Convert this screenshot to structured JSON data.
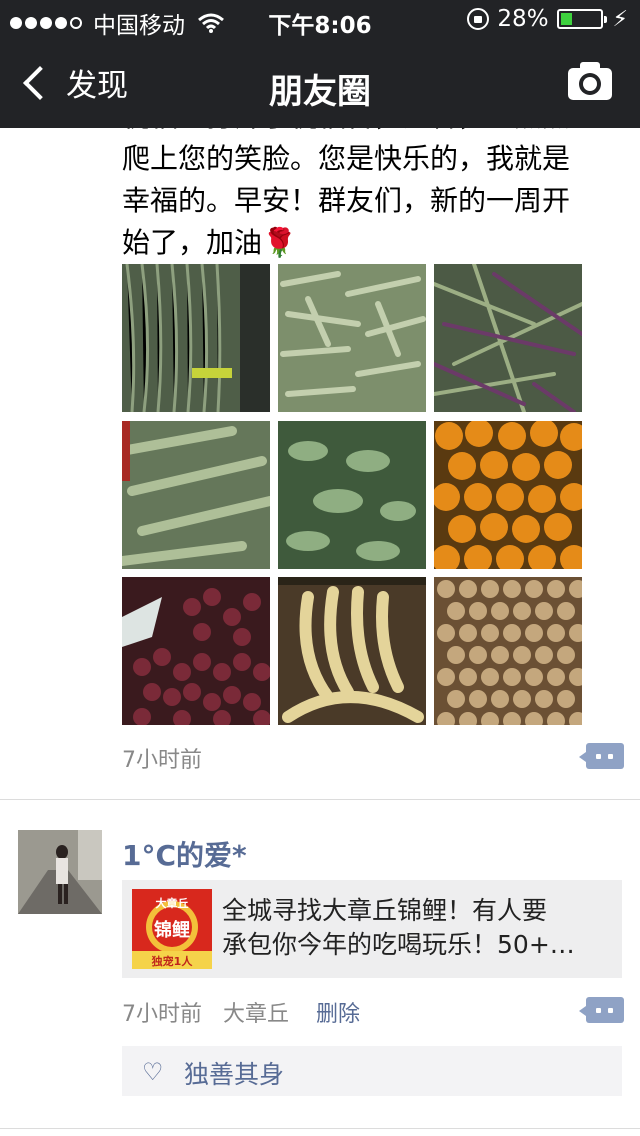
{
  "status_bar": {
    "carrier": "中国移动",
    "time": "下午8:06",
    "battery_text": "28%",
    "battery_level": 0.28
  },
  "nav": {
    "back_label": "发现",
    "title": "朋友圈"
  },
  "post1": {
    "text_lines": [
      "祝福…打开了祝福音，温馨，一点点",
      "爬上您的笑脸。您是快乐的，我就是",
      "幸福的。早安！群友们，新的一周开",
      "始了，加油🌹"
    ],
    "photos": [
      "green-long-beans",
      "pale-green-beans",
      "purple-green-beans",
      "flat-green-beans",
      "hyacinth-beans",
      "oranges",
      "red-grapes",
      "bananas",
      "longans"
    ],
    "time": "7小时前"
  },
  "post2": {
    "user": "1°C的爱*",
    "share_lines": [
      "全城寻找大章丘锦鲤！有人要",
      "承包你今年的吃喝玩乐！50+…"
    ],
    "thumb_label": "锦鲤",
    "thumb_top": "大章丘",
    "thumb_bottom": "独宠1人",
    "time": "7小时前",
    "location": "大章丘",
    "delete_label": "删除",
    "likes": [
      "独善其身"
    ]
  },
  "colors": {
    "header": "#222326",
    "link": "#576b95",
    "meta": "#888888"
  }
}
